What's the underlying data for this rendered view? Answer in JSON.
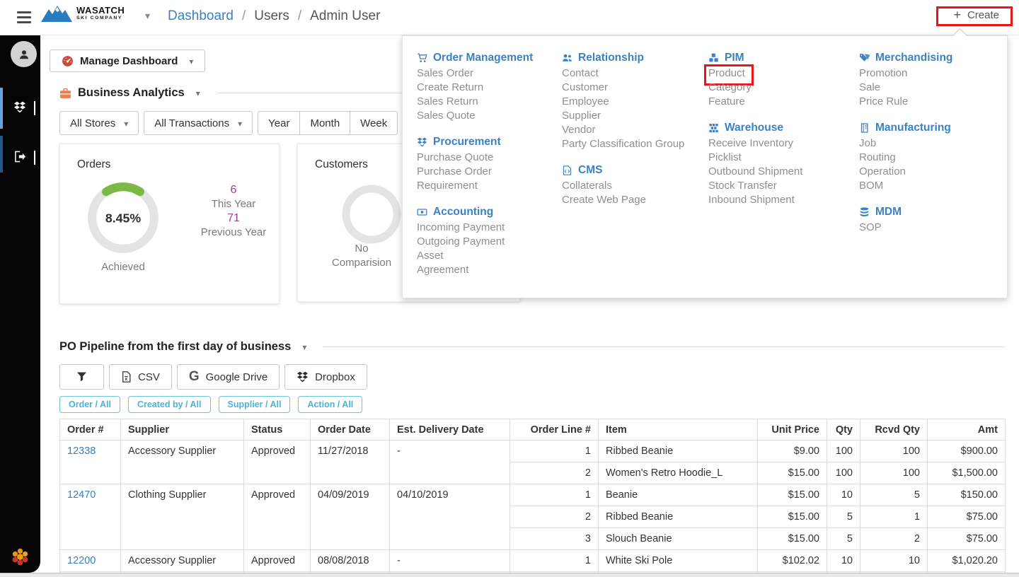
{
  "topbar": {
    "brand_line1": "WASATCH",
    "brand_line2": "SKI COMPANY",
    "breadcrumb": {
      "items": [
        "Dashboard",
        "Users",
        "Admin User"
      ],
      "separator": "/"
    },
    "create_label": "Create"
  },
  "sidebar": {
    "icons": [
      "user-avatar-icon",
      "dropbox-icon",
      "sign-out-icon",
      "flower-logo-icon"
    ]
  },
  "menu": {
    "columns": [
      {
        "sections": [
          {
            "icon": "cart-icon",
            "title": "Order Management",
            "items": [
              "Sales Order",
              "Create Return",
              "Sales Return",
              "Sales Quote"
            ]
          },
          {
            "icon": "dropbox-icon",
            "title": "Procurement",
            "items": [
              "Purchase Quote",
              "Purchase Order",
              "Requirement"
            ]
          },
          {
            "icon": "money-icon",
            "title": "Accounting",
            "items": [
              "Incoming Payment",
              "Outgoing Payment",
              "Asset",
              "Agreement"
            ]
          }
        ]
      },
      {
        "sections": [
          {
            "icon": "users-icon",
            "title": "Relationship",
            "items": [
              "Contact",
              "Customer",
              "Employee",
              "Supplier",
              "Vendor",
              "Party Classification Group"
            ]
          },
          {
            "icon": "file-code-icon",
            "title": "CMS",
            "items": [
              "Collaterals",
              "Create Web Page"
            ]
          }
        ]
      },
      {
        "sections": [
          {
            "icon": "cubes-icon",
            "title": "PIM",
            "items": [
              "Product",
              "Category",
              "Feature"
            ]
          },
          {
            "icon": "boxes-icon",
            "title": "Warehouse",
            "items": [
              "Receive Inventory",
              "Picklist",
              "Outbound Shipment",
              "Stock Transfer",
              "Inbound Shipment"
            ]
          }
        ]
      },
      {
        "sections": [
          {
            "icon": "tags-icon",
            "title": "Merchandising",
            "items": [
              "Promotion",
              "Sale",
              "Price Rule"
            ]
          },
          {
            "icon": "industry-icon",
            "title": "Manufacturing",
            "items": [
              "Job",
              "Routing",
              "Operation",
              "BOM"
            ]
          },
          {
            "icon": "database-icon",
            "title": "MDM",
            "items": [
              "SOP"
            ]
          }
        ]
      }
    ]
  },
  "annotations": {
    "highlighted_button": "Create",
    "highlighted_menu_item": "Product",
    "highlight_color": "#e8161b"
  },
  "dashboard": {
    "manage_button_label": "Manage Dashboard",
    "analytics_title": "Business Analytics",
    "filters": {
      "stores_label": "All Stores",
      "transactions_label": "All Transactions",
      "period_buttons": [
        "Year",
        "Month",
        "Week"
      ]
    },
    "orders_card": {
      "title": "Orders",
      "percent": "8.45%",
      "percent_label": "Achieved",
      "this_year_value": "6",
      "this_year_label": "This Year",
      "previous_year_value": "71",
      "previous_year_label": "Previous Year"
    },
    "customers_card": {
      "title": "Customers",
      "empty_line1": "No",
      "empty_line2": "Comparision"
    }
  },
  "chart_data": [
    {
      "type": "donut",
      "title": "Orders",
      "achieved_percent": 8.45,
      "this_year": 6,
      "previous_year": 71,
      "arc_color": "#7cb944",
      "track_color": "#e4e4e4",
      "center_label": "8.45%",
      "caption": "Achieved"
    },
    {
      "type": "donut",
      "title": "Customers",
      "values": [],
      "note": "No Comparision",
      "track_color": "#e4e4e4"
    }
  ],
  "po": {
    "title": "PO Pipeline from the first day of business",
    "toolbar": {
      "csv_label": "CSV",
      "gdrive_label": "Google Drive",
      "dropbox_label": "Dropbox"
    },
    "chips": [
      "Order / All",
      "Created by / All",
      "Supplier / All",
      "Action / All"
    ],
    "table": {
      "columns": [
        "Order #",
        "Supplier",
        "Status",
        "Order Date",
        "Est. Delivery Date",
        "Order Line #",
        "Item",
        "Unit Price",
        "Qty",
        "Rcvd Qty",
        "Amt"
      ],
      "orders": [
        {
          "order_no": "12338",
          "supplier": "Accessory Supplier",
          "status": "Approved",
          "order_date": "11/27/2018",
          "est_delivery": "-",
          "lines": [
            {
              "line_no": "1",
              "item": "Ribbed Beanie",
              "unit_price": "$9.00",
              "qty": "100",
              "rcvd_qty": "100",
              "amt": "$900.00"
            },
            {
              "line_no": "2",
              "item": "Women's Retro Hoodie_L",
              "unit_price": "$15.00",
              "qty": "100",
              "rcvd_qty": "100",
              "amt": "$1,500.00"
            }
          ]
        },
        {
          "order_no": "12470",
          "supplier": "Clothing Supplier",
          "status": "Approved",
          "order_date": "04/09/2019",
          "est_delivery": "04/10/2019",
          "lines": [
            {
              "line_no": "1",
              "item": "Beanie",
              "unit_price": "$15.00",
              "qty": "10",
              "rcvd_qty": "5",
              "amt": "$150.00"
            },
            {
              "line_no": "2",
              "item": "Ribbed Beanie",
              "unit_price": "$15.00",
              "qty": "5",
              "rcvd_qty": "1",
              "amt": "$75.00"
            },
            {
              "line_no": "3",
              "item": "Slouch Beanie",
              "unit_price": "$15.00",
              "qty": "5",
              "rcvd_qty": "2",
              "amt": "$75.00"
            }
          ]
        },
        {
          "order_no": "12200",
          "supplier": "Accessory Supplier",
          "status": "Approved",
          "order_date": "08/08/2018",
          "est_delivery": "-",
          "lines": [
            {
              "line_no": "1",
              "item": "White Ski Pole",
              "unit_price": "$102.02",
              "qty": "10",
              "rcvd_qty": "10",
              "amt": "$1,020.20"
            }
          ]
        }
      ]
    }
  },
  "colors": {
    "accent_blue": "#3a82c4",
    "link_blue": "#3b7fc4",
    "annotation_red": "#e8161b",
    "donut_green": "#7cb944",
    "stat_purple": "#9b3e98",
    "chip_blue": "#49b4d8",
    "briefcase_orange": "#ee7d51",
    "gauge_red": "#cf4a3c"
  }
}
